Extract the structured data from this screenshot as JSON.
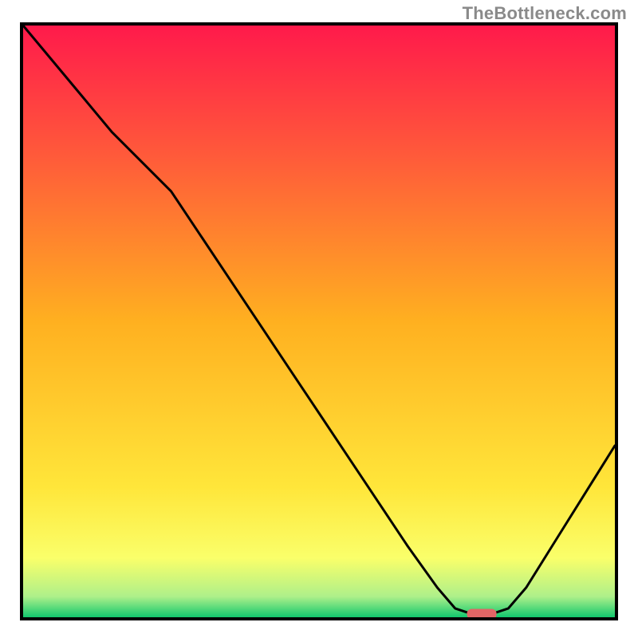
{
  "source": "TheBottleneck.com",
  "chart_data": {
    "type": "line",
    "title": "",
    "xlabel": "",
    "ylabel": "",
    "xlim": [
      0,
      100
    ],
    "ylim": [
      0,
      100
    ],
    "x": [
      0,
      5,
      10,
      15,
      20,
      25,
      30,
      35,
      40,
      45,
      50,
      55,
      60,
      65,
      70,
      73,
      76,
      79,
      82,
      85,
      90,
      95,
      100
    ],
    "values": [
      100,
      94,
      88,
      82,
      77,
      72,
      64.5,
      57,
      49.5,
      42,
      34.5,
      27,
      19.5,
      12,
      5,
      1.5,
      0.5,
      0.5,
      1.5,
      5,
      13,
      21,
      29
    ],
    "marker": {
      "x_start": 75,
      "x_end": 80,
      "y": 0.6
    },
    "gradient_stops": [
      {
        "offset": 0.0,
        "color": "#ff1a4b"
      },
      {
        "offset": 0.22,
        "color": "#ff5a3a"
      },
      {
        "offset": 0.5,
        "color": "#ffb020"
      },
      {
        "offset": 0.78,
        "color": "#ffe63a"
      },
      {
        "offset": 0.9,
        "color": "#faff6a"
      },
      {
        "offset": 0.965,
        "color": "#aef08a"
      },
      {
        "offset": 1.0,
        "color": "#12c86e"
      }
    ],
    "marker_color": "#e16666",
    "line_color": "#000000"
  }
}
